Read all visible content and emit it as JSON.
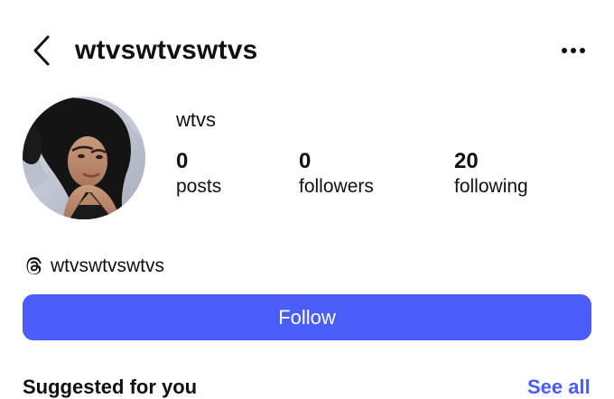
{
  "header": {
    "username": "wtvswtvswtvs",
    "back_icon": "chevron-left-icon",
    "more_icon": "more-horizontal-icon"
  },
  "profile": {
    "display_name": "wtvs",
    "avatar_icon": "profile-avatar-photo",
    "stats": {
      "posts": {
        "count": "0",
        "label": "posts"
      },
      "followers": {
        "count": "0",
        "label": "followers"
      },
      "following": {
        "count": "20",
        "label": "following"
      }
    },
    "threads": {
      "icon": "threads-logo-icon",
      "handle": "wtvswtvswtvs"
    }
  },
  "actions": {
    "follow_label": "Follow",
    "follow_color": "#4a5df9"
  },
  "suggested": {
    "title": "Suggested for you",
    "see_all": "See all"
  }
}
